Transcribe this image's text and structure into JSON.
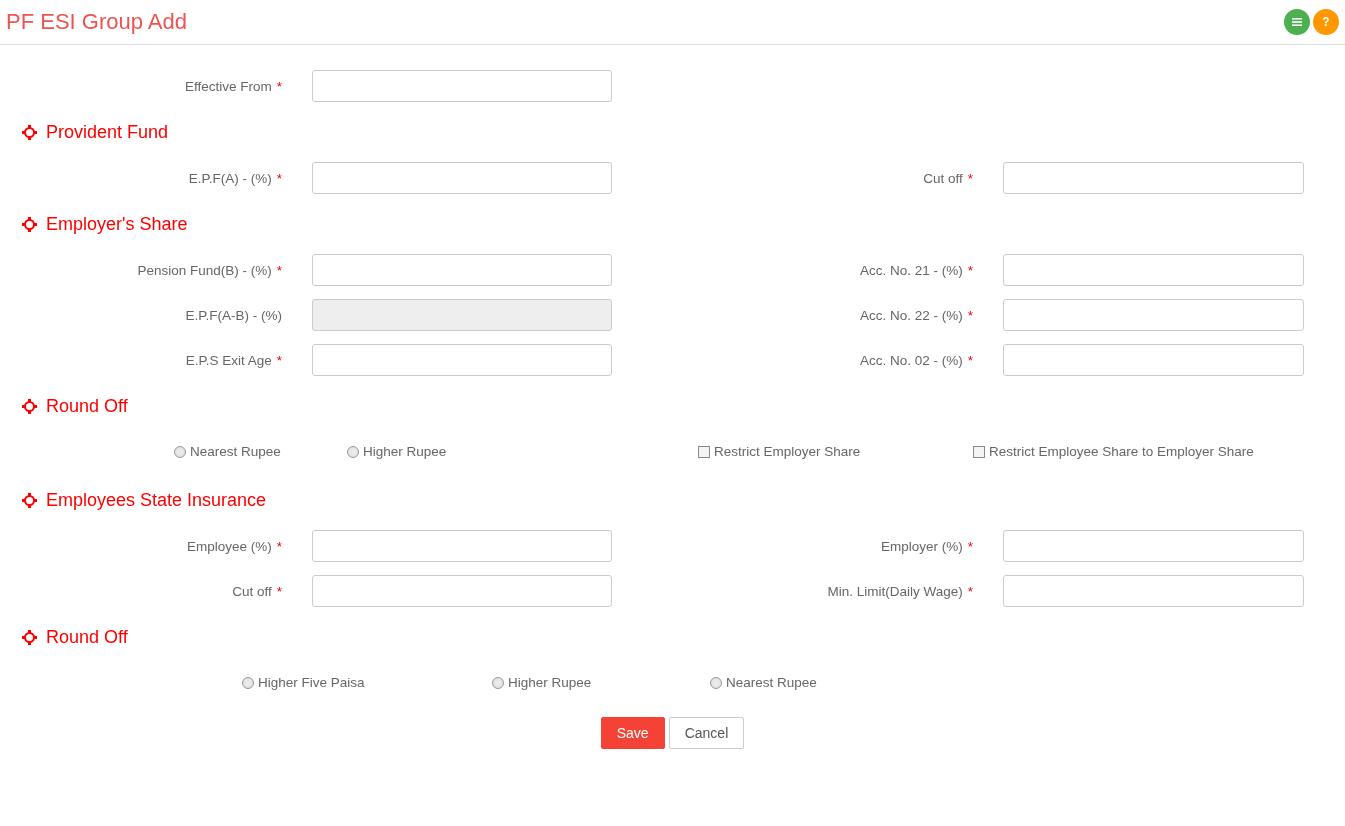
{
  "title": "PF ESI Group Add",
  "header_buttons": [
    {
      "kind": "menu"
    },
    {
      "kind": "help",
      "label": "?"
    }
  ],
  "sections": [
    {
      "kind": "fields",
      "rows": [
        [
          {
            "label": "Effective From",
            "mark": "*",
            "disabled": false
          }
        ]
      ]
    },
    {
      "kind": "fields",
      "heading": "Provident Fund",
      "rows": [
        [
          {
            "label": "E.P.F(A) - (%)",
            "mark": "*",
            "disabled": false
          },
          {
            "label": "Cut off",
            "mark": "*",
            "disabled": false
          }
        ]
      ]
    },
    {
      "kind": "fields",
      "heading": "Employer's Share",
      "rows": [
        [
          {
            "label": "Pension Fund(B) - (%)",
            "mark": "*",
            "disabled": false
          },
          {
            "label": "Acc. No. 21 - (%)",
            "mark": "*",
            "disabled": false
          }
        ],
        [
          {
            "label": "E.P.F(A-B) - (%)",
            "disabled": true
          },
          {
            "label": "Acc. No. 22 - (%)",
            "mark": "*",
            "disabled": false
          }
        ],
        [
          {
            "label": "E.P.S Exit Age",
            "mark": "*",
            "disabled": false
          },
          {
            "label": "Acc. No. 02 - (%)",
            "mark": "*",
            "disabled": false
          }
        ]
      ]
    },
    {
      "kind": "options",
      "heading": "Round Off",
      "options": [
        {
          "kind": "radio",
          "label": "Nearest Rupee",
          "selected": false
        },
        {
          "kind": "radio",
          "label": "Higher Rupee",
          "selected": false
        },
        {
          "kind": "checkbox",
          "label": "Restrict Employer Share",
          "checked": false
        },
        {
          "kind": "checkbox",
          "label": "Restrict Employee Share to Employer Share",
          "checked": false
        }
      ]
    },
    {
      "kind": "fields",
      "heading": "Employees State Insurance",
      "rows": [
        [
          {
            "label": "Employee (%)",
            "mark": "*",
            "disabled": false
          },
          {
            "label": "Employer (%)",
            "mark": "*",
            "disabled": false
          }
        ],
        [
          {
            "label": "Cut off",
            "mark": "*",
            "disabled": false
          },
          {
            "label": "Min. Limit(Daily Wage)",
            "mark": "*",
            "disabled": false
          }
        ]
      ]
    },
    {
      "kind": "options",
      "heading": "Round Off",
      "options": [
        {
          "kind": "radio",
          "label": "Higher Five Paisa",
          "selected": false
        },
        {
          "kind": "radio",
          "label": "Higher Rupee",
          "selected": false
        },
        {
          "kind": "radio",
          "label": "Nearest Rupee",
          "selected": false
        }
      ]
    }
  ],
  "actions": [
    {
      "kind": "primary",
      "label": "Save"
    },
    {
      "kind": "default",
      "label": "Cancel"
    }
  ]
}
